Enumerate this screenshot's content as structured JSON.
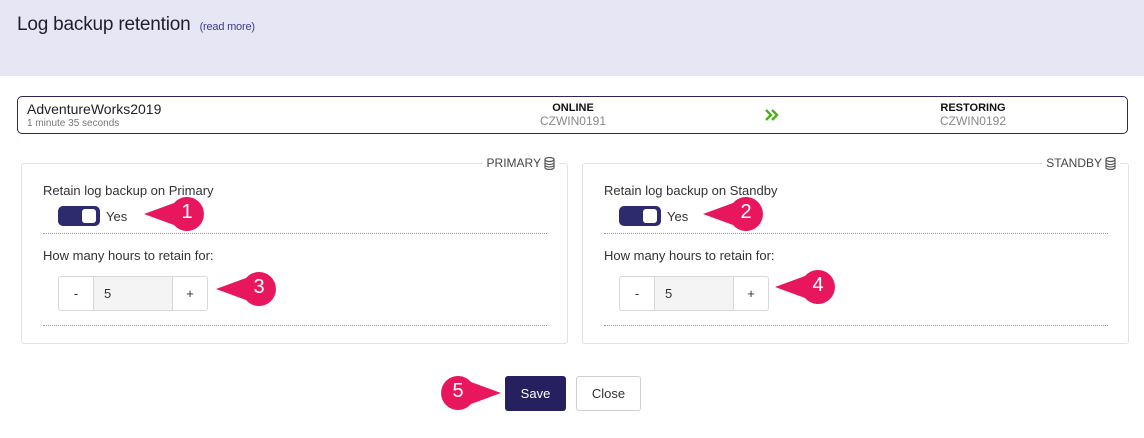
{
  "header": {
    "title": "Log backup retention",
    "read_more": "(read more)"
  },
  "status": {
    "db_name": "AdventureWorks2019",
    "elapsed": "1 minute 35 seconds",
    "primary": {
      "state": "ONLINE",
      "host": "CZWIN0191"
    },
    "standby": {
      "state": "RESTORING",
      "host": "CZWIN0192"
    },
    "transfer_icon": "double-chevron-right-icon",
    "accent_color": "#4caf1a"
  },
  "panels": {
    "primary": {
      "legend": "PRIMARY",
      "icon": "database-icon",
      "retain_label": "Retain log backup on Primary",
      "toggle_text": "Yes",
      "hours_label": "How many hours to retain for:",
      "minus": "-",
      "value": "5",
      "plus": "+"
    },
    "standby": {
      "legend": "STANDBY",
      "icon": "database-icon",
      "retain_label": "Retain log backup on Standby",
      "toggle_text": "Yes",
      "hours_label": "How many hours to retain for:",
      "minus": "-",
      "value": "5",
      "plus": "+"
    }
  },
  "callouts": [
    "1",
    "2",
    "3",
    "4",
    "5"
  ],
  "callout_color": "#e8175d",
  "actions": {
    "save": "Save",
    "close": "Close"
  },
  "colors": {
    "header_bg": "#e6e6f5",
    "brand": "#27205f"
  }
}
